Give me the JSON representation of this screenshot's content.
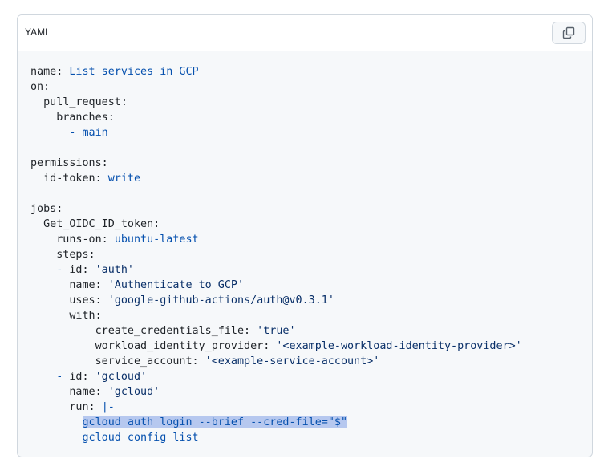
{
  "header": {
    "language": "YAML",
    "copy_icon": "copy-icon"
  },
  "code": {
    "lines": [
      [
        {
          "t": "name: ",
          "c": "key"
        },
        {
          "t": "List services in GCP",
          "c": "val"
        }
      ],
      [
        {
          "t": "on:",
          "c": "key"
        }
      ],
      [
        {
          "t": "  pull_request:",
          "c": "key"
        }
      ],
      [
        {
          "t": "    branches:",
          "c": "key"
        }
      ],
      [
        {
          "t": "      - main",
          "c": "val"
        }
      ],
      [],
      [
        {
          "t": "permissions:",
          "c": "key"
        }
      ],
      [
        {
          "t": "  id-token: ",
          "c": "key"
        },
        {
          "t": "write",
          "c": "val"
        }
      ],
      [],
      [
        {
          "t": "jobs:",
          "c": "key"
        }
      ],
      [
        {
          "t": "  Get_OIDC_ID_token:",
          "c": "key"
        }
      ],
      [
        {
          "t": "    runs-on: ",
          "c": "key"
        },
        {
          "t": "ubuntu-latest",
          "c": "val"
        }
      ],
      [
        {
          "t": "    steps:",
          "c": "key"
        }
      ],
      [
        {
          "t": "    - ",
          "c": "val"
        },
        {
          "t": "id: ",
          "c": "key"
        },
        {
          "t": "'auth'",
          "c": "str"
        }
      ],
      [
        {
          "t": "      name: ",
          "c": "key"
        },
        {
          "t": "'Authenticate to GCP'",
          "c": "str"
        }
      ],
      [
        {
          "t": "      uses: ",
          "c": "key"
        },
        {
          "t": "'google-github-actions/auth@v0.3.1'",
          "c": "str"
        }
      ],
      [
        {
          "t": "      with:",
          "c": "key"
        }
      ],
      [
        {
          "t": "          create_credentials_file: ",
          "c": "key"
        },
        {
          "t": "'true'",
          "c": "str"
        }
      ],
      [
        {
          "t": "          workload_identity_provider: ",
          "c": "key"
        },
        {
          "t": "'<example-workload-identity-provider>'",
          "c": "str"
        }
      ],
      [
        {
          "t": "          service_account: ",
          "c": "key"
        },
        {
          "t": "'<example-service-account>'",
          "c": "str"
        }
      ],
      [
        {
          "t": "    - ",
          "c": "val"
        },
        {
          "t": "id: ",
          "c": "key"
        },
        {
          "t": "'gcloud'",
          "c": "str"
        }
      ],
      [
        {
          "t": "      name: ",
          "c": "key"
        },
        {
          "t": "'gcloud'",
          "c": "str"
        }
      ],
      [
        {
          "t": "      run: ",
          "c": "key"
        },
        {
          "t": "|-",
          "c": "val"
        }
      ],
      [
        {
          "t": "        ",
          "c": "key"
        },
        {
          "t": "gcloud auth login --brief --cred-file=\"$\"",
          "c": "val hl"
        }
      ],
      [
        {
          "t": "        gcloud config list",
          "c": "val"
        }
      ]
    ]
  },
  "colors": {
    "key": "#1f2328",
    "value": "#0550ae",
    "string": "#0a3069",
    "selection": "#b6c8ef",
    "border": "#d0d7de",
    "code_background": "#f6f8fa"
  }
}
